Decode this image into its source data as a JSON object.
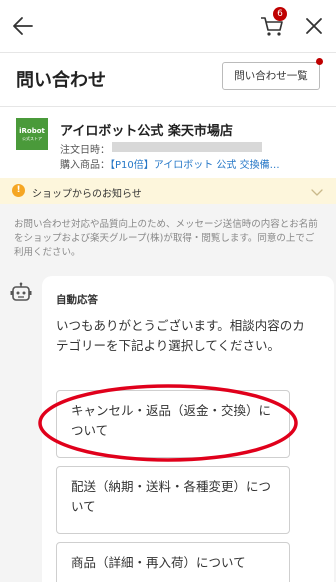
{
  "header": {
    "cart_count": "6",
    "icons": {
      "back": "arrow-left-icon",
      "cart": "cart-icon",
      "close": "close-icon"
    }
  },
  "page": {
    "title": "問い合わせ",
    "inquiry_list_button": "問い合わせ一覧"
  },
  "shop": {
    "logo_text": "iRobot",
    "logo_subtext": "公式ストア",
    "name": "アイロボット公式 楽天市場店",
    "order_date_label": "注文日時：",
    "product_label": "購入商品：",
    "product_link": "【P10倍】アイロボット 公式 交換備…"
  },
  "notice": {
    "icon_glyph": "!",
    "text": "ショップからのお知らせ"
  },
  "disclaimer": "お問い合わせ対応や品質向上のため、メッセージ送信時の内容とお名前をショップおよび楽天グループ(株)が取得・閲覧します。同意の上でご利用ください。",
  "chat": {
    "bubble_title": "自動応答",
    "message": "いつもありがとうございます。相談内容のカテゴリーを下記より選択してください。",
    "options": [
      "キャンセル・返品（返金・交換）について",
      "配送（納期・送料・各種変更）について",
      "商品（詳細・再入荷）について"
    ]
  },
  "colors": {
    "accent_red": "#bf0000",
    "link_blue": "#2577c7",
    "notice_bg": "#fdf6dc",
    "annotation_red": "#e0001b"
  }
}
